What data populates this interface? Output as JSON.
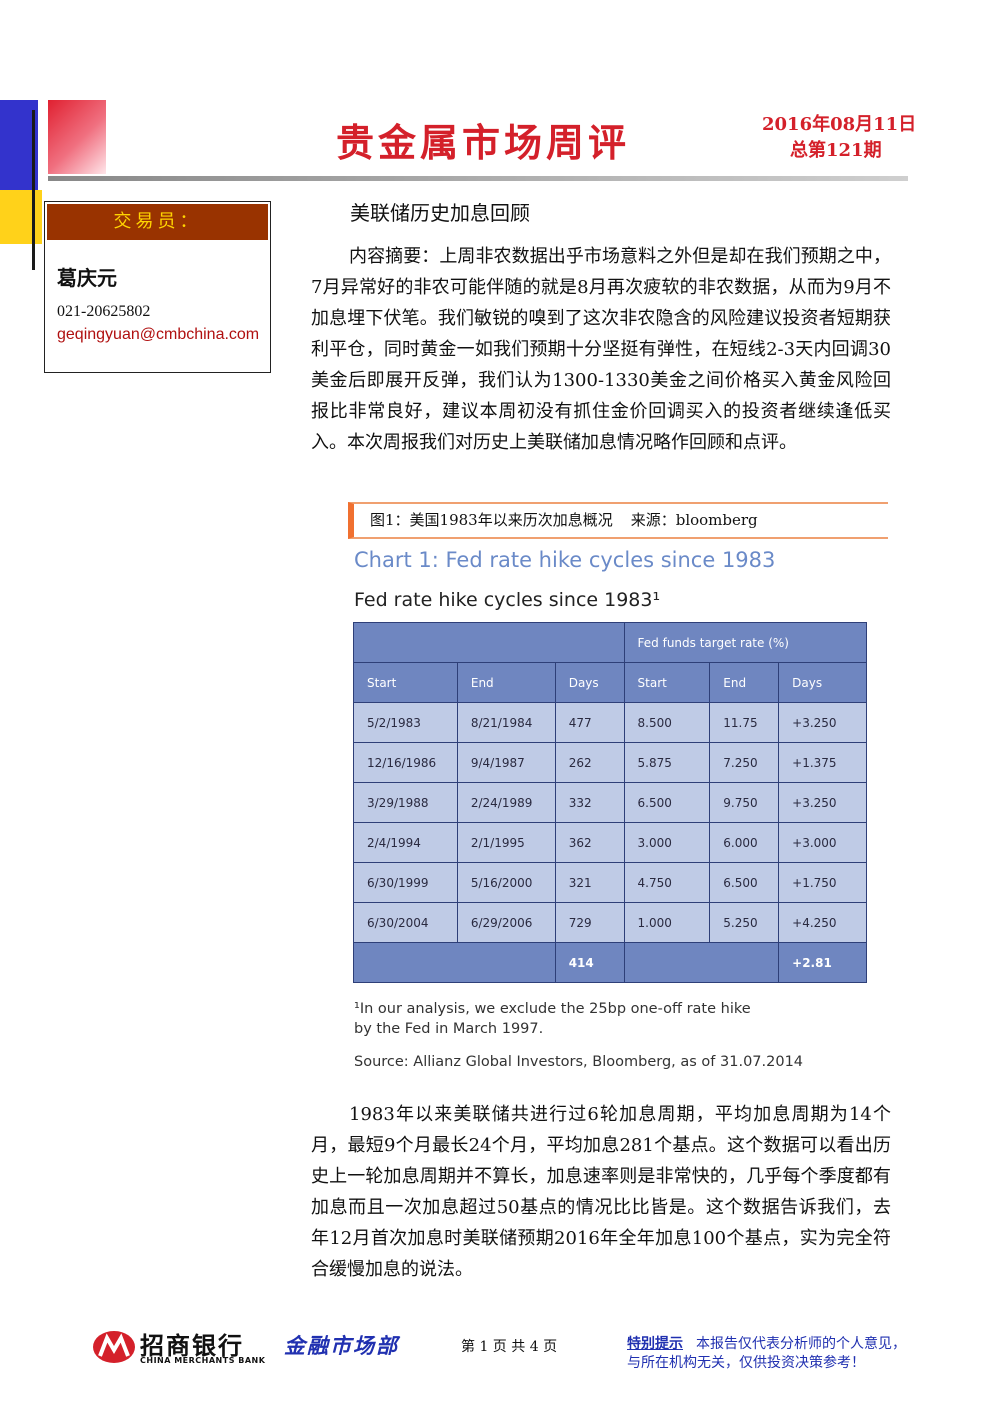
{
  "header": {
    "title": "贵金属市场周评",
    "date": "2016年08月11日",
    "issue": "总第121期"
  },
  "trader": {
    "heading": "交易员：",
    "name": "葛庆元",
    "phone": "021-20625802",
    "email": "geqingyuan@cmbchina.com"
  },
  "section_title": "美联储历史加息回顾",
  "summary": "内容摘要：上周非农数据出乎市场意料之外但是却在我们预期之中，7月异常好的非农可能伴随的就是8月再次疲软的非农数据，从而为9月不加息埋下伏笔。我们敏锐的嗅到了这次非农隐含的风险建议投资者短期获利平仓，同时黄金一如我们预期十分坚挺有弹性，在短线2-3天内回调30美金后即展开反弹，我们认为1300-1330美金之间价格买入黄金风险回报比非常良好，建议本周初没有抓住金价回调买入的投资者继续逢低买入。本次周报我们对历史上美联储加息情况略作回顾和点评。",
  "figure": {
    "caption": "图1：美国1983年以来历次加息概况",
    "source": "来源：bloomberg",
    "chart_title": "Chart 1: Fed rate hike cycles since 1983",
    "chart_subtitle": "Fed rate hike cycles since 1983¹",
    "group_header": "Fed funds target rate (%)",
    "columns": [
      "Start",
      "End",
      "Days",
      "Start",
      "End",
      "Days"
    ],
    "rows": [
      [
        "5/2/1983",
        "8/21/1984",
        "477",
        "8.500",
        "11.75",
        "+3.250"
      ],
      [
        "12/16/1986",
        "9/4/1987",
        "262",
        "5.875",
        "7.250",
        "+1.375"
      ],
      [
        "3/29/1988",
        "2/24/1989",
        "332",
        "6.500",
        "9.750",
        "+3.250"
      ],
      [
        "2/4/1994",
        "2/1/1995",
        "362",
        "3.000",
        "6.000",
        "+3.000"
      ],
      [
        "6/30/1999",
        "5/16/2000",
        "321",
        "4.750",
        "6.500",
        "+1.750"
      ],
      [
        "6/30/2004",
        "6/29/2006",
        "729",
        "1.000",
        "5.250",
        "+4.250"
      ]
    ],
    "total_days": "414",
    "total_change": "+2.81",
    "footnote_line1": "¹In our analysis, we exclude the 25bp one-off rate hike",
    "footnote_line2": "by the Fed in March 1997.",
    "source_line": "Source: Allianz Global Investors, Bloomberg, as of 31.07.2014"
  },
  "analysis": "1983年以来美联储共进行过6轮加息周期，平均加息周期为14个月，最短9个月最长24个月，平均加息281个基点。这个数据可以看出历史上一轮加息周期并不算长，加息速率则是非常快的，几乎每个季度都有加息而且一次加息超过50基点的情况比比皆是。这个数据告诉我们，去年12月首次加息时美联储预期2016年全年加息100个基点，实为完全符合缓慢加息的说法。",
  "footer": {
    "bank_name": "招商银行",
    "bank_name_en": "CHINA MERCHANTS BANK",
    "department": "金融市场部",
    "page": "第 1 页 共 4 页",
    "notice_label": "特别提示",
    "notice_text": "本报告仅代表分析师的个人意见，",
    "notice_text2": "与所在机构无关，仅供投资决策参考！"
  },
  "colors": {
    "title_red": "#d4202a",
    "table_header": "#6f86c0",
    "table_body": "#bfcbe6",
    "chart_title_blue": "#6a8ac8",
    "footer_blue": "#2030b0"
  }
}
